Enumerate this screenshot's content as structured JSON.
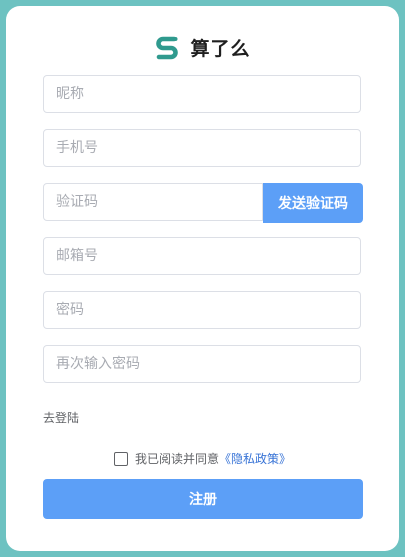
{
  "brand": {
    "name": "算了么",
    "accent_color": "#2f9a8e",
    "logo_icon": "s-logo-icon"
  },
  "form": {
    "nickname_placeholder": "昵称",
    "phone_placeholder": "手机号",
    "code_placeholder": "验证码",
    "send_code_label": "发送验证码",
    "email_placeholder": "邮箱号",
    "password_placeholder": "密码",
    "confirm_password_placeholder": "再次输入密码",
    "nickname_value": "",
    "phone_value": "",
    "code_value": "",
    "email_value": "",
    "password_value": "",
    "confirm_password_value": ""
  },
  "login_link": "去登陆",
  "agreement": {
    "checked": false,
    "text": "我已阅读并同意",
    "policy_link": "《隐私政策》"
  },
  "submit_label": "注册",
  "colors": {
    "background": "#6dc2c1",
    "primary_button": "#5c9ff7",
    "link": "#3773d6"
  }
}
